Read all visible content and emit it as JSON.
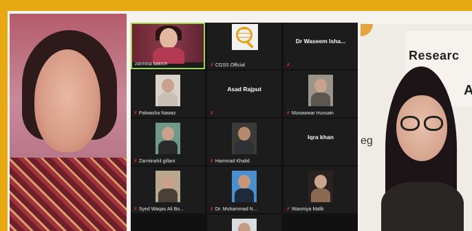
{
  "meeting": {
    "gallery": [
      {
        "name": "zarmina baloch",
        "type": "camera",
        "active": true
      },
      {
        "name": "CGSS Official",
        "type": "logo"
      },
      {
        "name": "",
        "display_name": "Dr Waseem Isha...",
        "type": "name-only"
      },
      {
        "name": "Palwasha Nawaz",
        "type": "photo"
      },
      {
        "name": "",
        "display_name": "Asad Rajput",
        "type": "name-only"
      },
      {
        "name": "Munawwar Hussain",
        "type": "photo"
      },
      {
        "name": "Zarminahil gillani",
        "type": "photo"
      },
      {
        "name": "Hammad Khalid",
        "type": "photo"
      },
      {
        "name": "",
        "display_name": "Iqra khan",
        "type": "name-only"
      },
      {
        "name": "Syed Waqas Ali Bo...",
        "type": "photo"
      },
      {
        "name": "Dr. Muhammad N...",
        "type": "photo"
      },
      {
        "name": "Wasmiya Malik",
        "type": "photo"
      },
      {
        "name": "",
        "type": "photo-partial"
      }
    ],
    "right_banner_text": "Researc",
    "right_banner_text2": "A",
    "right_side_text": "eg"
  },
  "colors": {
    "frame": "#e7a812",
    "active_border": "#9cd84a",
    "muted_mic": "#e0302a",
    "gallery_bg": "#111111"
  },
  "icons": {
    "mic_muted": "muted-microphone-icon"
  }
}
